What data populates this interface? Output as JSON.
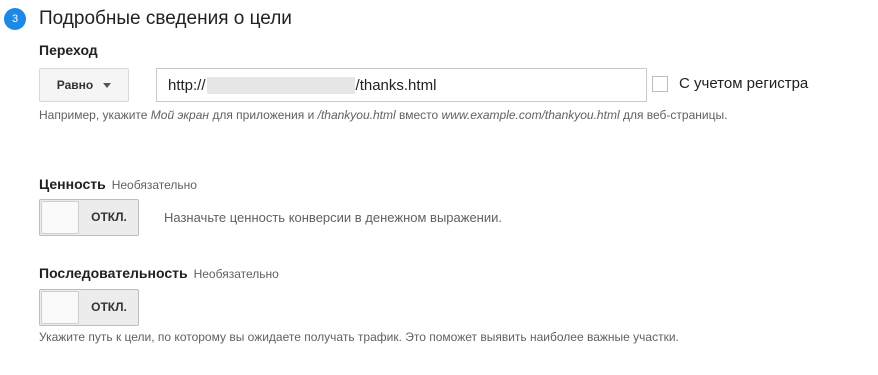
{
  "step": {
    "number": "3",
    "title": "Подробные сведения о цели"
  },
  "destination": {
    "label": "Переход",
    "match_type": "Равно",
    "url_prefix": "http://",
    "url_suffix": "/thanks.html",
    "case_sensitive_label": "С учетом регистра",
    "case_sensitive_checked": false,
    "hint": {
      "part1": "Например, укажите ",
      "italic1": "Мой экран",
      "part2": " для приложения и ",
      "italic2": "/thankyou.html",
      "part3": " вместо ",
      "italic3": "www.example.com/thankyou.html",
      "part4": " для веб-страницы."
    }
  },
  "value": {
    "label": "Ценность",
    "optional": "Необязательно",
    "toggle_state": "ОТКЛ.",
    "description": "Назначьте ценность конверсии в денежном выражении."
  },
  "funnel": {
    "label": "Последовательность",
    "optional": "Необязательно",
    "toggle_state": "ОТКЛ.",
    "description": "Укажите путь к цели, по которому вы ожидаете получать трафик. Это поможет выявить наиболее важные участки."
  },
  "colors": {
    "accent": "#1e88e5",
    "text": "#212121",
    "muted": "#616161"
  }
}
